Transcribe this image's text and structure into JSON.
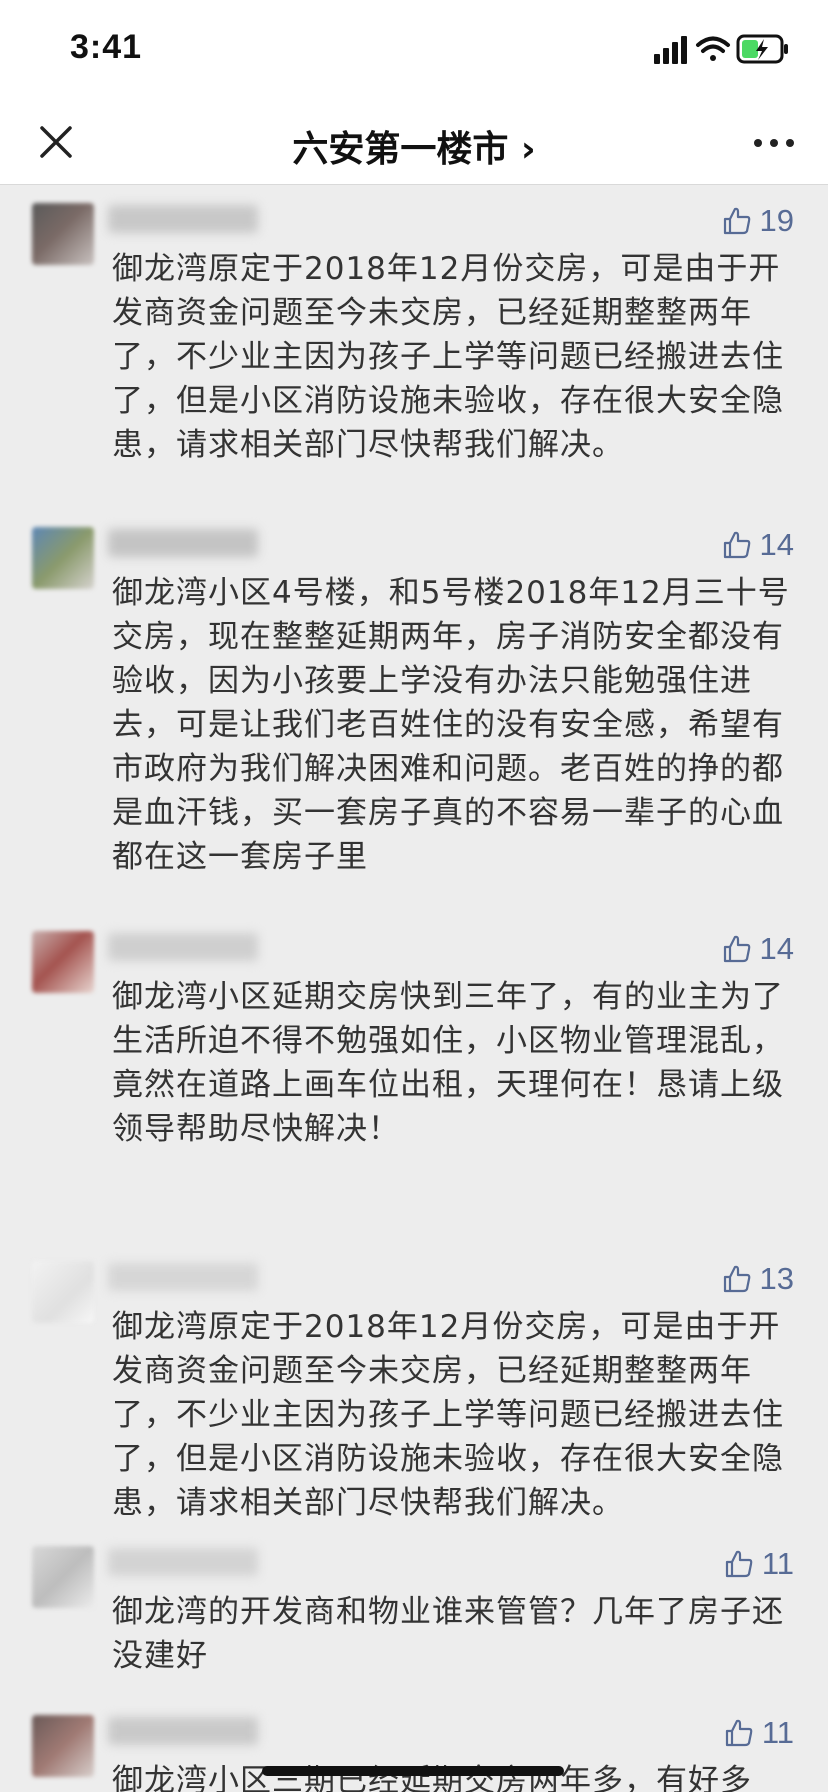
{
  "status_bar": {
    "time": "3:41"
  },
  "nav": {
    "title": "六安第一楼市 ›"
  },
  "comments": [
    {
      "likes": "19",
      "text": "御龙湾原定于2018年12月份交房，可是由于开发商资金问题至今未交房，已经延期整整两年了，不少业主因为孩子上学等问题已经搬进去住了，但是小区消防设施未验收，存在很大安全隐患，请求相关部门尽快帮我们解决。"
    },
    {
      "likes": "14",
      "text": "御龙湾小区4号楼，和5号楼2018年12月三十号交房，现在整整延期两年，房子消防安全都没有验收，因为小孩要上学没有办法只能勉强住进去，可是让我们老百姓住的没有安全感，希望有市政府为我们解决困难和问题。老百姓的挣的都是血汗钱，买一套房子真的不容易一辈子的心血都在这一套房子里"
    },
    {
      "likes": "14",
      "text": "御龙湾小区延期交房快到三年了，有的业主为了生活所迫不得不勉强如住，小区物业管理混乱，竟然在道路上画车位出租，天理何在！恳请上级领导帮助尽快解决！"
    },
    {
      "likes": "13",
      "text": "御龙湾原定于2018年12月份交房，可是由于开发商资金问题至今未交房，已经延期整整两年了，不少业主因为孩子上学等问题已经搬进去住了，但是小区消防设施未验收，存在很大安全隐患，请求相关部门尽快帮我们解决。"
    },
    {
      "likes": "11",
      "text": "御龙湾的开发商和物业谁来管管？几年了房子还没建好"
    },
    {
      "likes": "11",
      "text": "御龙湾小区三期已经延期交房两年多，有好多"
    }
  ],
  "colors": {
    "like_blue": "#576b95",
    "background": "#ededed"
  },
  "icons": {
    "close": "close-icon",
    "more": "more-icon",
    "like": "thumbs-up-icon"
  }
}
